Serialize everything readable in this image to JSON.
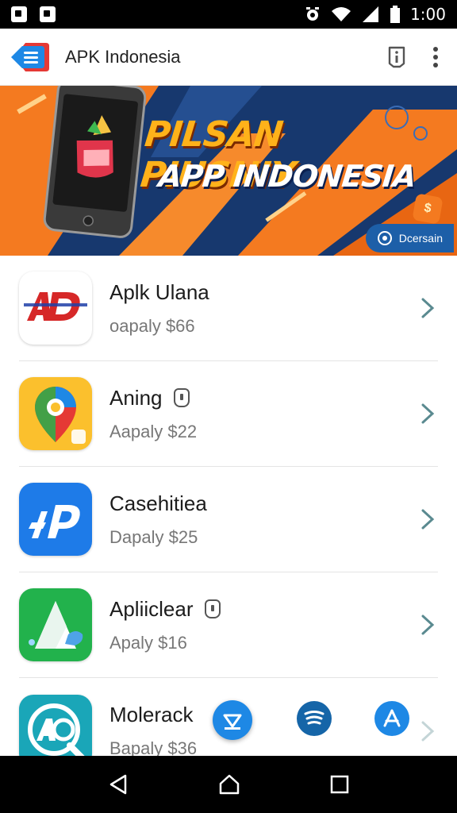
{
  "status_bar": {
    "time": "1:00",
    "icons": [
      "notification-icon",
      "app-notification-icon",
      "alarm-icon",
      "wifi-icon",
      "signal-icon",
      "battery-icon"
    ]
  },
  "app_bar": {
    "title": "APK Indonesia",
    "actions": [
      "info-icon",
      "more-vert-icon"
    ]
  },
  "banner": {
    "headline": "PILSAN PIUSNIY",
    "subheadline": "APP INDONESIA",
    "chip_label": "Dcersain",
    "badge_text": "$"
  },
  "apps": [
    {
      "name": "Aplk Ulana",
      "subtitle": "oapaly $66",
      "icon": "ad-icon",
      "badge": false
    },
    {
      "name": "Aning",
      "subtitle": "Aapaly $22",
      "icon": "map-pin-icon",
      "badge": true
    },
    {
      "name": "Casehitiea",
      "subtitle": "Dapaly $25",
      "icon": "p-logo-icon",
      "badge": false
    },
    {
      "name": "Apliiclear",
      "subtitle": "Apaly $16",
      "icon": "triangle-icon",
      "badge": true
    },
    {
      "name": "Molerack",
      "subtitle": "Bapaly $36",
      "icon": "search-logo-icon",
      "badge": false
    }
  ],
  "floating": [
    "download-icon",
    "spotify-icon",
    "app-store-icon"
  ],
  "nav_bar": [
    "back-icon",
    "home-icon",
    "recents-icon"
  ],
  "colors": {
    "banner_orange": "#f47a20",
    "banner_navy": "#17386e",
    "headline_gold": "#ffb21a",
    "fab_blue": "#1e88e5",
    "spotify_blue": "#1565a8"
  }
}
